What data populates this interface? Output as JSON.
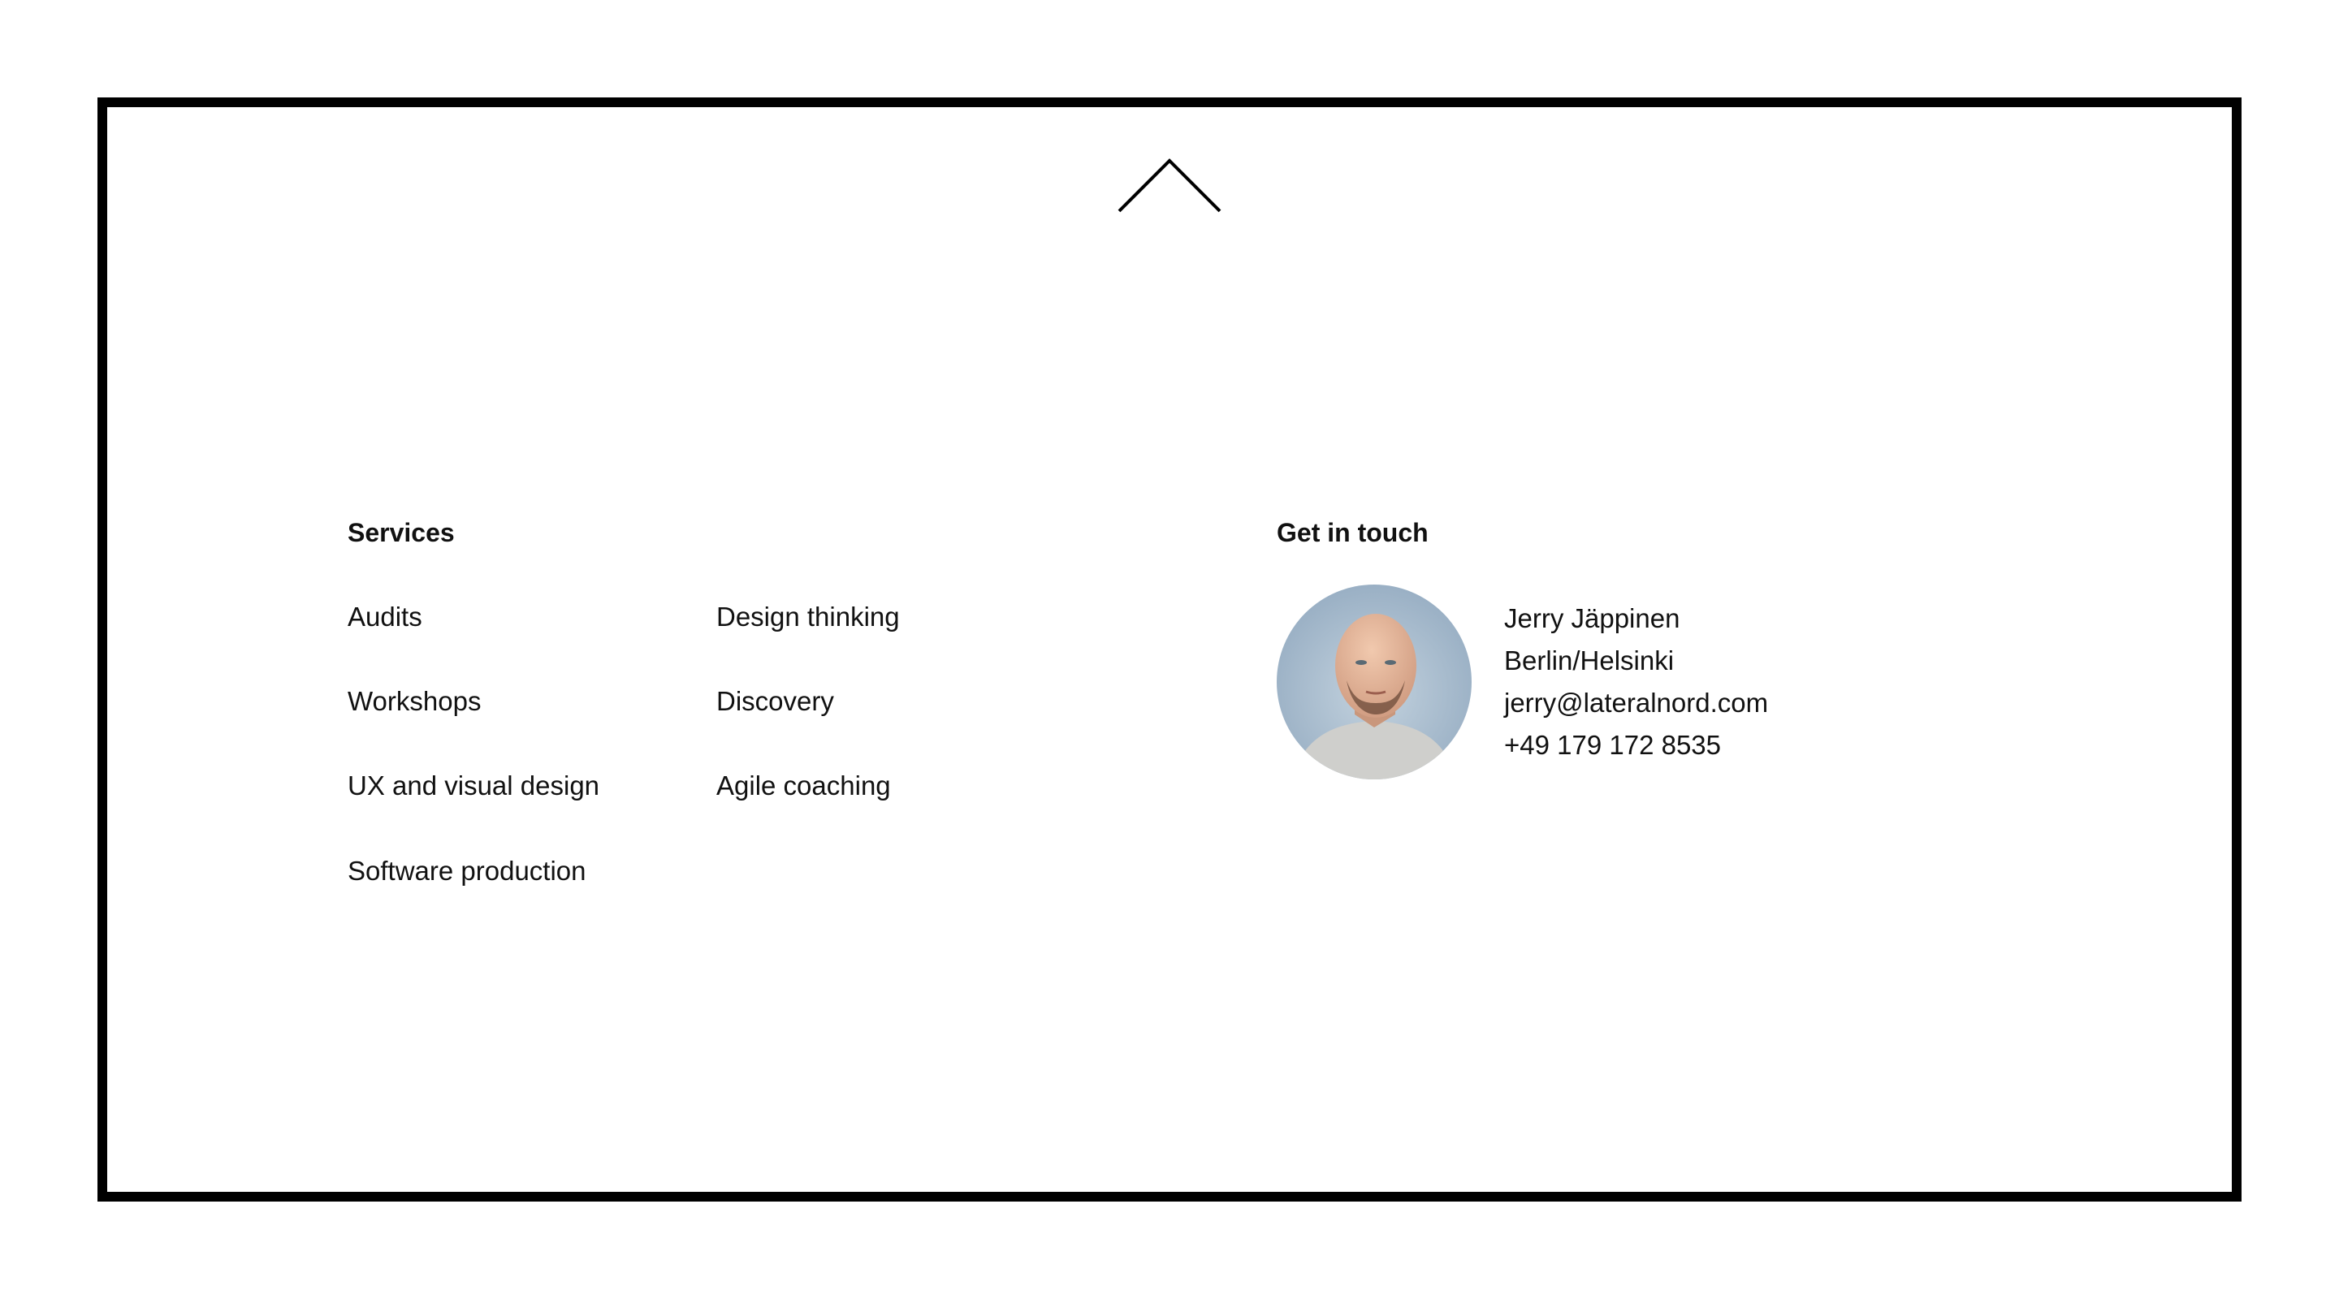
{
  "nav": {
    "scroll_top_icon": "chevron-up-icon"
  },
  "services": {
    "heading": "Services",
    "column1": [
      "Audits",
      "Workshops",
      "UX and visual design",
      "Software production"
    ],
    "column2": [
      "Design thinking",
      "Discovery",
      "Agile coaching"
    ]
  },
  "contact": {
    "heading": "Get in touch",
    "name": "Jerry Jäppinen",
    "location": "Berlin/Helsinki",
    "email": "jerry@lateralnord.com",
    "phone": "+49 179 172 8535"
  }
}
